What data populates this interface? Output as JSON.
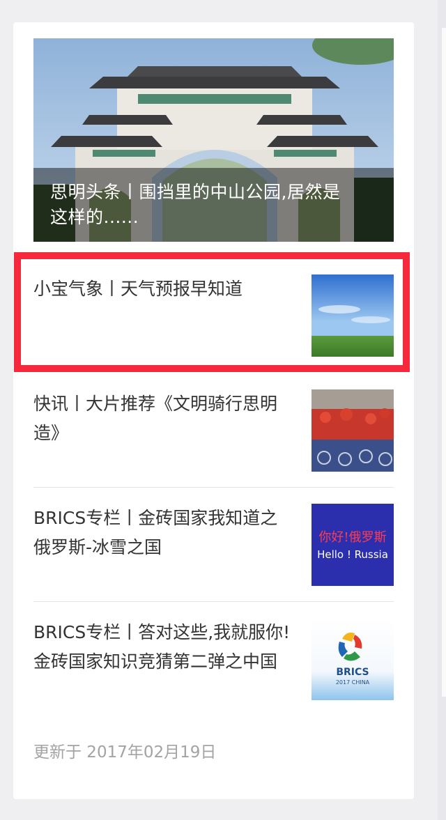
{
  "hero": {
    "title": "思明头条丨围挡里的中山公园,居然是这样的......",
    "image": "zhongshan-park-gate-photo"
  },
  "articles": [
    {
      "title": "小宝气象丨天气预报早知道",
      "thumbnail": "sky-field-photo",
      "highlighted": true
    },
    {
      "title": "快讯丨大片推荐《文明骑行思明造》",
      "thumbnail": "bike-crowd-photo"
    },
    {
      "title": "BRICS专栏丨金砖国家我知道之俄罗斯-冰雪之国",
      "thumbnail": "hello-russia-graphic"
    },
    {
      "title": "BRICS专栏丨答对这些,我就服你!金砖国家知识竞猜第二弹之中国",
      "thumbnail": "brics-2017-china-logo"
    }
  ],
  "thumbs": {
    "russia": {
      "line1": "你好!俄罗斯",
      "line2": "Hello ! Russia"
    },
    "brics": {
      "name": "BRICS",
      "sub": "2017 CHINA"
    }
  },
  "footer": {
    "updated": "更新于 2017年02月19日"
  },
  "colors": {
    "highlight_border": "#f5283c",
    "russia_bg": "#2b2fae",
    "footer_text": "#a3a3a3"
  }
}
